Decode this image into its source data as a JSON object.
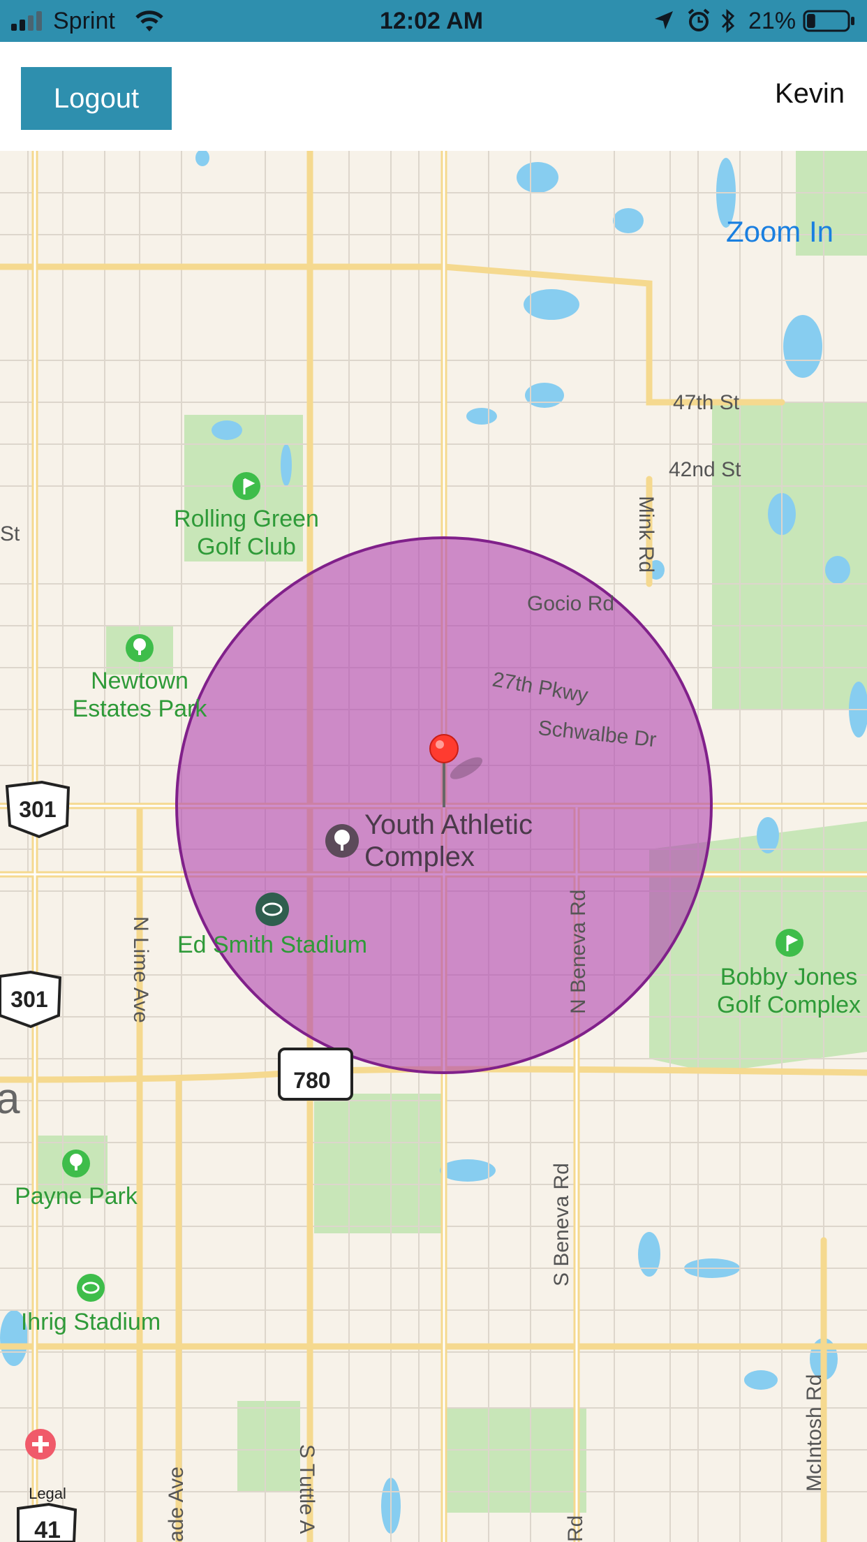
{
  "status_bar": {
    "carrier": "Sprint",
    "time": "12:02 AM",
    "battery_percent": "21%",
    "battery_level": 0.21,
    "icons": [
      "signal-bars-icon",
      "wifi-icon",
      "location-arrow-icon",
      "alarm-icon",
      "bluetooth-icon",
      "battery-icon"
    ]
  },
  "nav": {
    "logout_label": "Logout",
    "username": "Kevin"
  },
  "map": {
    "zoom_in_label": "Zoom In",
    "pin_color": "#ff3b30",
    "radius_fill": "#b045b0",
    "streets": {
      "s47th": "47th St",
      "s42nd": "42nd St",
      "mink": "Mink Rd",
      "gocio": "Gocio Rd",
      "pkwy27": "27th Pkwy",
      "schwalbe": "Schwalbe Dr",
      "nbeneva": "N Beneva Rd",
      "sbeneva": "S Beneva Rd",
      "nlime": "N Lime Ave",
      "stuttle": "S Tuttle A",
      "mcintosh": "McIntosh Rd",
      "ade": "ade Ave",
      "rd": "Rd",
      "st_left": "St",
      "a_left": "a"
    },
    "places": {
      "rolling1": "Rolling Green",
      "rolling2": "Golf Club",
      "newtown1": "Newtown",
      "newtown2": "Estates Park",
      "youth1": "Youth Athletic",
      "youth2": "Complex",
      "edsmith": "Ed Smith Stadium",
      "bobby1": "Bobby Jones",
      "bobby2": "Golf Complex",
      "payne": "Payne Park",
      "ihrig": "Ihrig Stadium"
    },
    "shields": {
      "us301a": "301",
      "us301b": "301",
      "fl780": "780",
      "us41": "41",
      "legal": "Legal"
    }
  }
}
